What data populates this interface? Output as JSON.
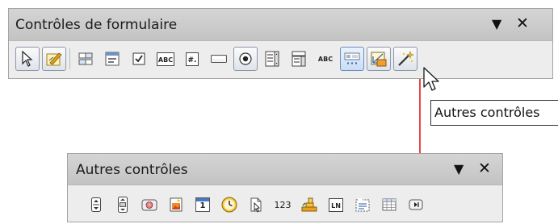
{
  "form_controls_toolbar": {
    "title": "Contrôles de formulaire",
    "menu_glyph": "▼",
    "close_glyph": "✕",
    "buttons": [
      {
        "name": "select-icon",
        "label": ""
      },
      {
        "name": "design-mode-icon",
        "label": ""
      },
      {
        "name": "form-design-icon",
        "label": ""
      },
      {
        "name": "control-properties-icon",
        "label": ""
      },
      {
        "name": "check-box-icon",
        "label": ""
      },
      {
        "name": "text-box-icon",
        "label": "ABC"
      },
      {
        "name": "formatted-field-icon",
        "label": "#."
      },
      {
        "name": "push-button-icon",
        "label": ""
      },
      {
        "name": "option-button-icon",
        "label": ""
      },
      {
        "name": "list-box-icon",
        "label": ""
      },
      {
        "name": "combo-box-icon",
        "label": ""
      },
      {
        "name": "label-field-icon",
        "label": "ABC"
      },
      {
        "name": "more-controls-icon",
        "label": ""
      },
      {
        "name": "form-design-toggle-icon",
        "label": ""
      },
      {
        "name": "wizards-icon",
        "label": ""
      }
    ]
  },
  "tooltip": {
    "text": "Autres contrôles"
  },
  "more_controls_toolbar": {
    "title": "Autres contrôles",
    "menu_glyph": "▼",
    "close_glyph": "✕",
    "buttons": [
      {
        "name": "spin-button-icon",
        "label": ""
      },
      {
        "name": "scrollbar-icon",
        "label": ""
      },
      {
        "name": "image-button-icon",
        "label": ""
      },
      {
        "name": "image-control-icon",
        "label": ""
      },
      {
        "name": "date-field-icon",
        "label": "1"
      },
      {
        "name": "time-field-icon",
        "label": ""
      },
      {
        "name": "file-selection-icon",
        "label": ""
      },
      {
        "name": "numerical-field-icon",
        "label": "123"
      },
      {
        "name": "currency-field-icon",
        "label": ""
      },
      {
        "name": "pattern-field-icon",
        "label": "LN"
      },
      {
        "name": "group-box-icon",
        "label": ""
      },
      {
        "name": "table-control-icon",
        "label": ""
      },
      {
        "name": "navigation-bar-icon",
        "label": ""
      }
    ]
  },
  "colors": {
    "arrow": "#e01b1b",
    "toolbar_bg": "#ededed",
    "title_bg": "#c9c9c9"
  }
}
